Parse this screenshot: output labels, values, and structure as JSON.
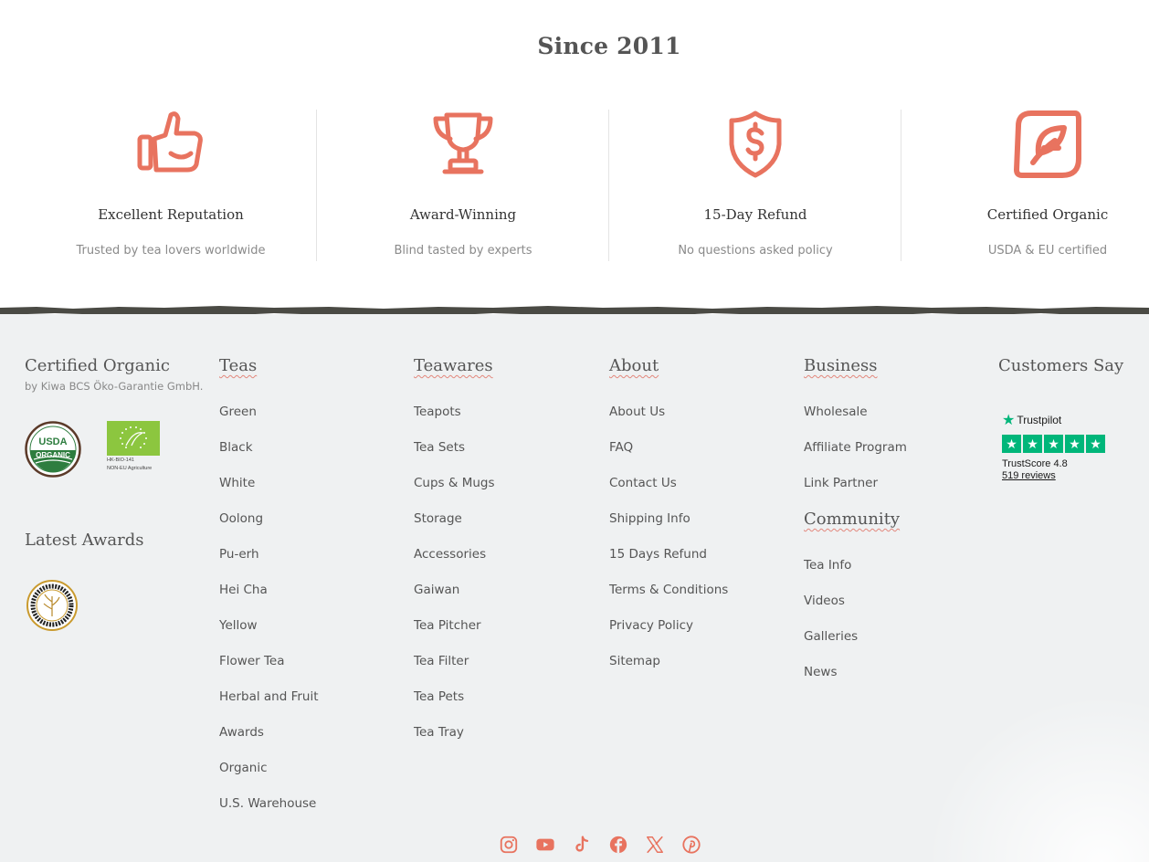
{
  "colors": {
    "accent": "#e8735f",
    "footer_bg": "#eff1f2",
    "trustpilot_green": "#00b67a"
  },
  "header": {
    "title": "Since 2011"
  },
  "features": [
    {
      "icon": "thumbs-up-icon",
      "title": "Excellent Reputation",
      "subtitle": "Trusted by tea lovers worldwide"
    },
    {
      "icon": "trophy-icon",
      "title": "Award-Winning",
      "subtitle": "Blind tasted by experts"
    },
    {
      "icon": "shield-dollar-icon",
      "title": "15-Day Refund",
      "subtitle": "No questions asked policy"
    },
    {
      "icon": "organic-leaf-icon",
      "title": "Certified Organic",
      "subtitle": "USDA & EU certified"
    }
  ],
  "certified": {
    "heading": "Certified Organic",
    "sub": "by Kiwa BCS Öko-Garantie GmbH.",
    "usda_line1": "USDA",
    "usda_line2": "ORGANIC",
    "eu_text1": "HK-BIO-141",
    "eu_text2": "NON-EU Agriculture",
    "awards_heading": "Latest Awards"
  },
  "teas": {
    "heading": "Teas",
    "items": [
      "Green",
      "Black",
      "White",
      "Oolong",
      "Pu-erh",
      "Hei Cha",
      "Yellow",
      "Flower Tea",
      "Herbal and Fruit",
      "Awards",
      "Organic",
      "U.S. Warehouse"
    ]
  },
  "teawares": {
    "heading": "Teawares",
    "items": [
      "Teapots",
      "Tea Sets",
      "Cups & Mugs",
      "Storage",
      "Accessories",
      "Gaiwan",
      "Tea Pitcher",
      "Tea Filter",
      "Tea Pets",
      "Tea Tray"
    ]
  },
  "about": {
    "heading": "About",
    "items": [
      "About Us",
      "FAQ",
      "Contact Us",
      "Shipping Info",
      "15 Days Refund",
      "Terms & Conditions",
      "Privacy Policy",
      "Sitemap"
    ]
  },
  "business": {
    "heading": "Business",
    "items": [
      "Wholesale",
      "Affiliate Program",
      "Link Partner"
    ]
  },
  "community": {
    "heading": "Community",
    "items": [
      "Tea Info",
      "Videos",
      "Galleries",
      "News"
    ]
  },
  "customers": {
    "heading": "Customers Say",
    "brand": "Trustpilot",
    "score": "TrustScore 4.8",
    "reviews": "519 reviews",
    "rating_stars": 5
  },
  "social": [
    "instagram-icon",
    "youtube-icon",
    "tiktok-icon",
    "facebook-icon",
    "x-icon",
    "pinterest-icon"
  ]
}
